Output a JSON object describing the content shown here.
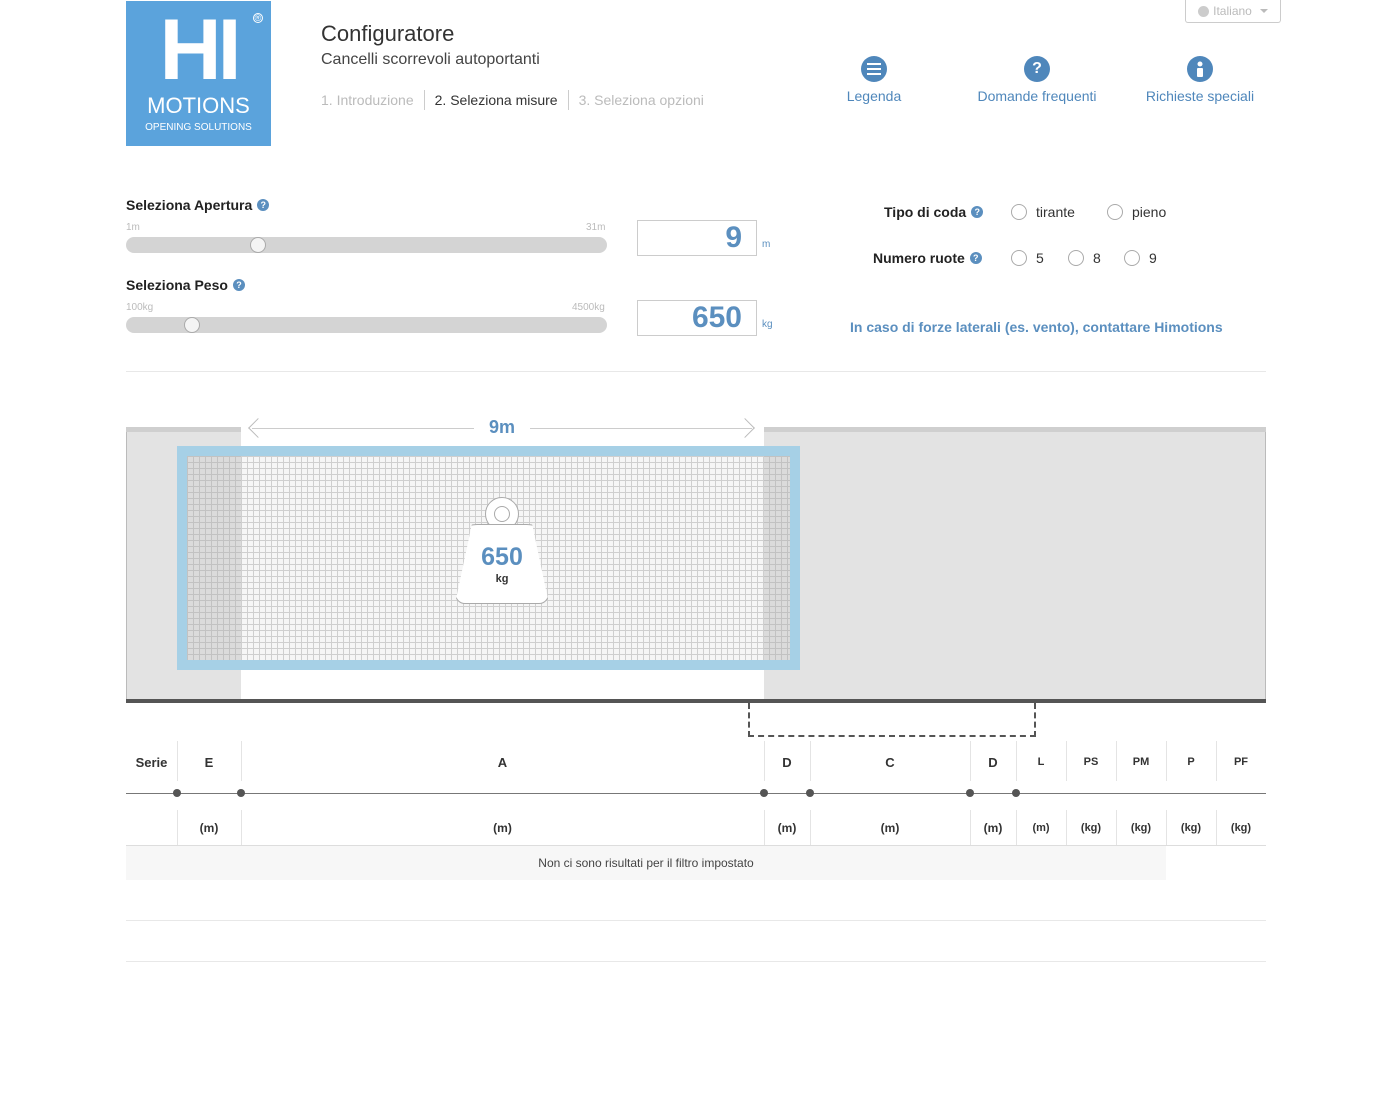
{
  "logo": {
    "main": "HI",
    "registered": "®",
    "brand": "MOTIONS",
    "tagline": "OPENING SOLUTIONS"
  },
  "header": {
    "title": "Configuratore",
    "subtitle": "Cancelli scorrevoli autoportanti",
    "steps": [
      "1. Introduzione",
      "2. Seleziona misure",
      "3. Seleziona opzioni"
    ],
    "active_step": 1
  },
  "language": {
    "selected": "Italiano"
  },
  "nav": [
    {
      "label": "Legenda",
      "icon": "menu-icon"
    },
    {
      "label": "Domande frequenti",
      "icon": "question-icon"
    },
    {
      "label": "Richieste speciali",
      "icon": "info-icon"
    }
  ],
  "apertura": {
    "label": "Seleziona Apertura",
    "min": "1m",
    "max": "31m",
    "value": "9",
    "unit": "m",
    "fraction": 0.267
  },
  "peso": {
    "label": "Seleziona Peso",
    "min": "100kg",
    "max": "4500kg",
    "value": "650",
    "unit": "kg",
    "fraction": 0.125
  },
  "tipo_coda": {
    "label": "Tipo di coda",
    "options": [
      "tirante",
      "pieno"
    ]
  },
  "numero_ruote": {
    "label": "Numero ruote",
    "options": [
      "5",
      "8",
      "9"
    ]
  },
  "warning": "In caso di forze laterali (es. vento), contattare Himotions",
  "diagram": {
    "opening_label": "9m",
    "weight_value": "650",
    "weight_unit": "kg"
  },
  "table": {
    "headers": [
      "Serie",
      "E",
      "A",
      "D",
      "C",
      "D",
      "L",
      "PS",
      "PM",
      "P",
      "PF"
    ],
    "units": [
      "",
      "(m)",
      "(m)",
      "(m)",
      "(m)",
      "(m)",
      "(m)",
      "(kg)",
      "(kg)",
      "(kg)",
      "(kg)"
    ],
    "empty_message": "Non ci sono risultati per il filtro impostato"
  },
  "colors": {
    "accent": "#5b8fbf",
    "logo_bg": "#5ba3dc",
    "gate_frame": "#a6d0e6"
  }
}
